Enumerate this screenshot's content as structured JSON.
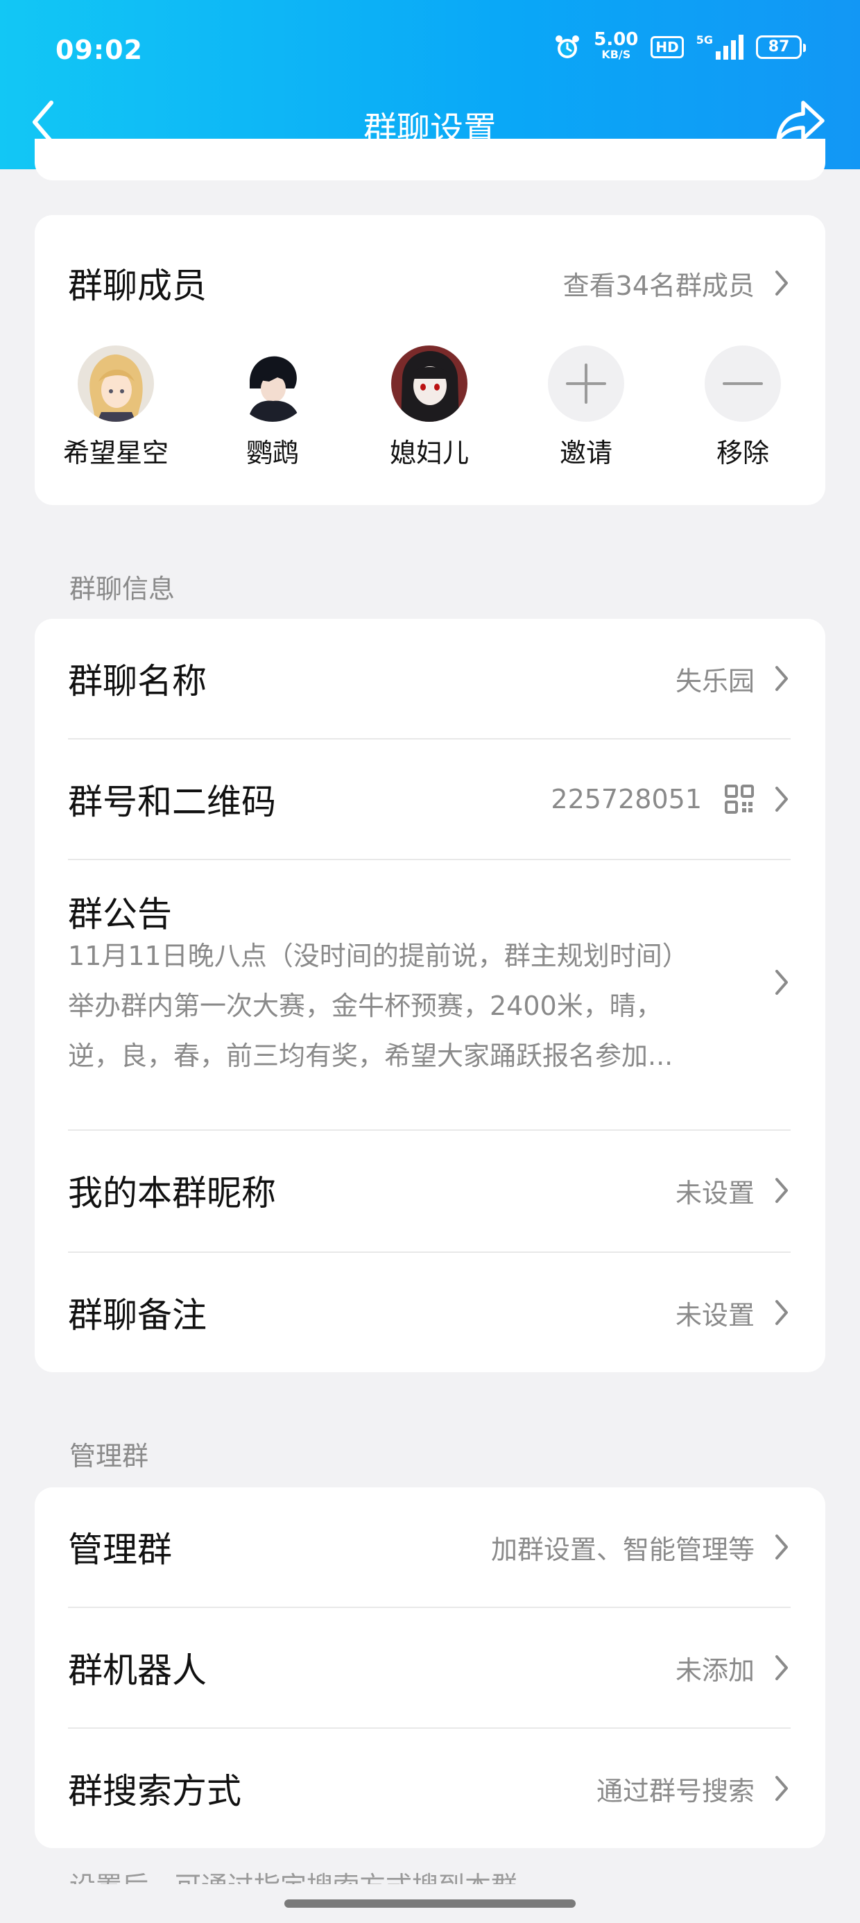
{
  "status_bar": {
    "time": "09:02",
    "speed_value": "5.00",
    "speed_unit": "KB/S",
    "hd": "HD",
    "network": "5G",
    "battery": "87"
  },
  "header": {
    "title": "群聊设置",
    "back_icon": "chevron-left-icon",
    "share_icon": "share-icon"
  },
  "members_card": {
    "title": "群聊成员",
    "view_all": "查看34名群成员",
    "members": [
      {
        "name": "希望星空",
        "avatar": "avatar-blonde-anime"
      },
      {
        "name": "鹦鹉",
        "avatar": "avatar-dark-hair-boy"
      },
      {
        "name": "媳妇儿",
        "avatar": "avatar-black-hair-girl"
      }
    ],
    "invite_label": "邀请",
    "remove_label": "移除"
  },
  "group_info": {
    "section_label": "群聊信息",
    "name_label": "群聊名称",
    "name_value": "失乐园",
    "number_label": "群号和二维码",
    "number_value": "225728051",
    "notice_label": "群公告",
    "notice_line1": "11月11日晚八点（没时间的提前说，群主规划时间）",
    "notice_line2": "举办群内第一次大赛，金牛杯预赛，2400米，晴，",
    "notice_line3": "逆，良，春，前三均有奖，希望大家踊跃报名参加...",
    "nickname_label": "我的本群昵称",
    "nickname_value": "未设置",
    "remark_label": "群聊备注",
    "remark_value": "未设置"
  },
  "manage": {
    "section_label": "管理群",
    "manage_label": "管理群",
    "manage_value": "加群设置、智能管理等",
    "robot_label": "群机器人",
    "robot_value": "未添加",
    "search_label": "群搜索方式",
    "search_value": "通过群号搜索",
    "hint": "设置后，可通过指定搜索方式搜到本群"
  },
  "colors": {
    "header_start": "#12c7f5",
    "header_end": "#1297f5",
    "background": "#f2f2f4",
    "secondary_text": "#8a8a8a"
  }
}
